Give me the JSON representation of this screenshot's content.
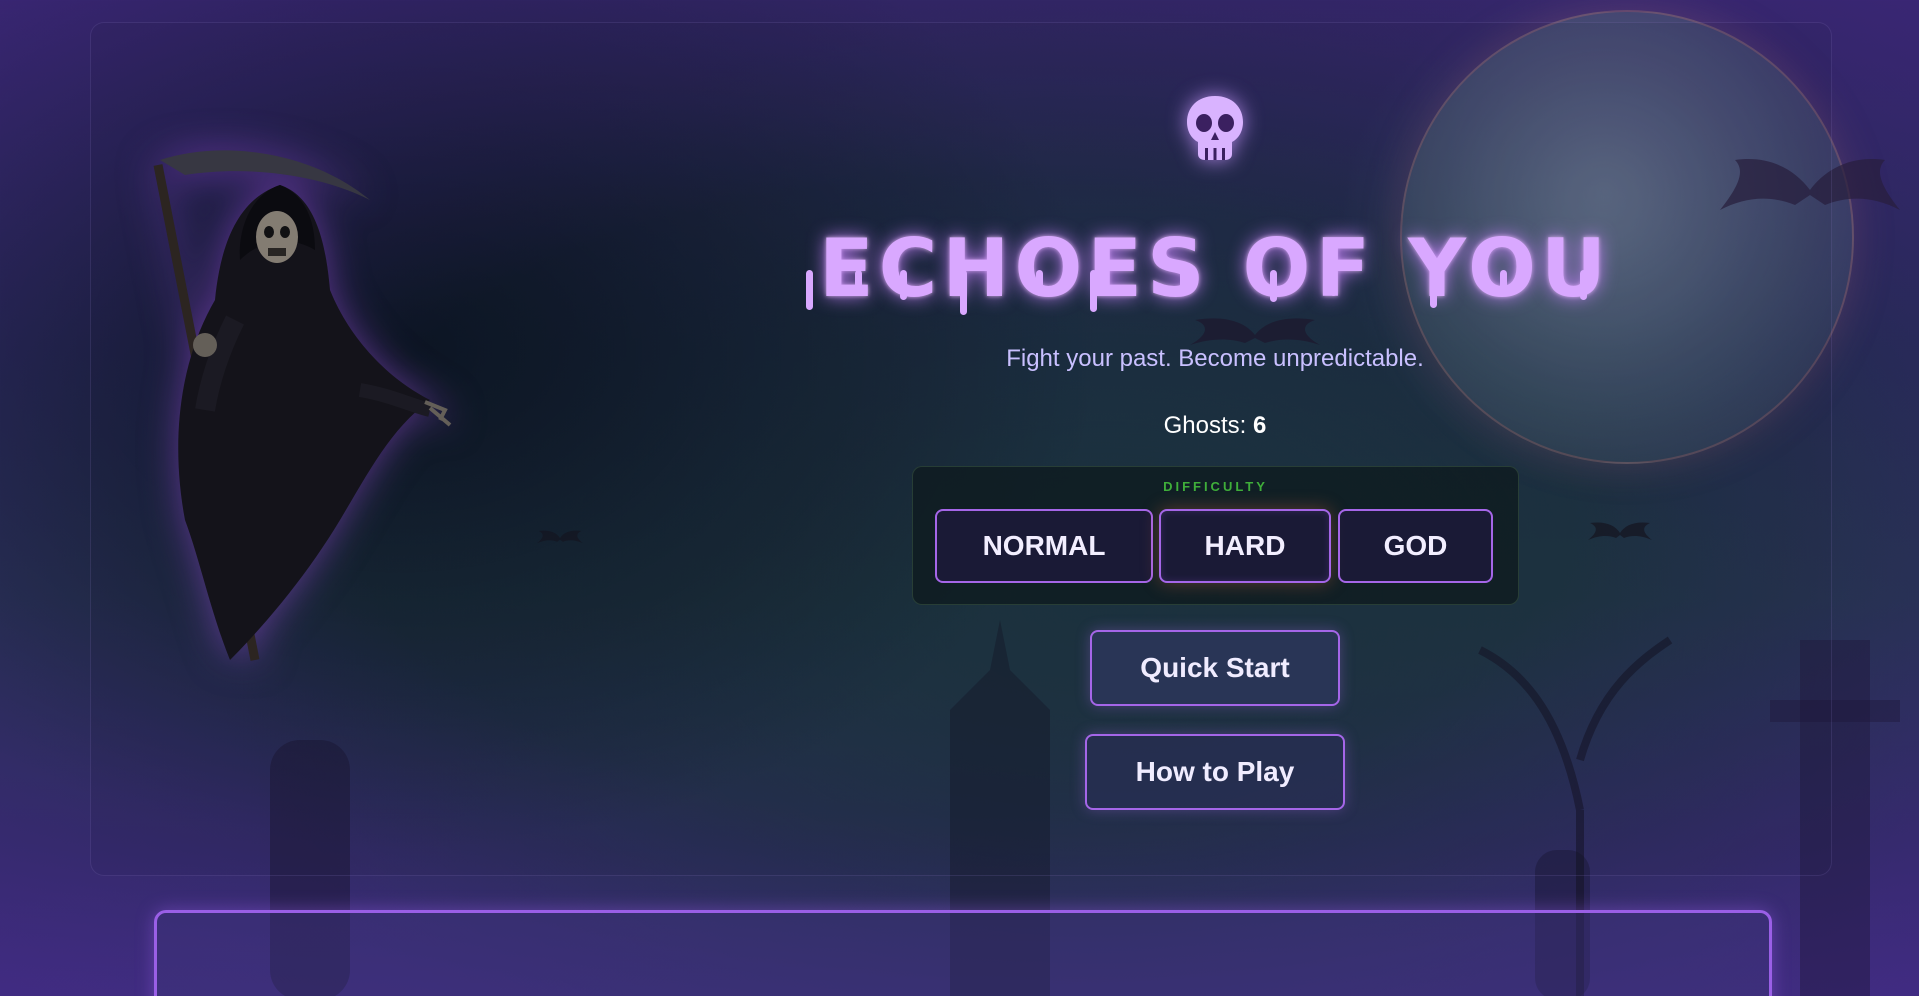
{
  "game": {
    "title": "ECHOES OF YOU",
    "subtitle": "Fight your past. Become unpredictable.",
    "ghosts_label": "Ghosts:",
    "ghosts_count": "6",
    "logo_icon": "skull-icon"
  },
  "difficulty": {
    "label": "DIFFICULTY",
    "options": [
      "NORMAL",
      "HARD",
      "GOD"
    ],
    "selected": "HARD"
  },
  "menu": {
    "quick_start": "Quick Start",
    "how_to_play": "How to Play"
  },
  "colors": {
    "accent": "#a566e8",
    "title": "#d9a8ff",
    "difficulty_label": "#3fae3a"
  }
}
